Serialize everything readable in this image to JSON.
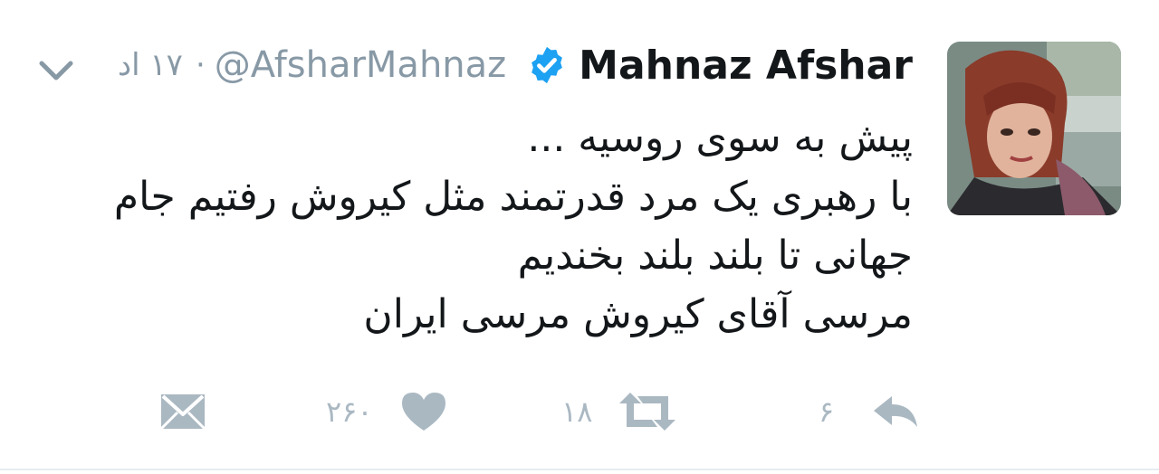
{
  "author": {
    "name": "Mahnaz Afshar",
    "handle": "@AfsharMahnaz",
    "time": "۱۷ اد",
    "separator": "·",
    "verified": true
  },
  "tweet": {
    "lines": [
      "پیش به سوی روسیه ...",
      "با رهبری یک مرد قدرتمند مثل کیروش رفتیم جام",
      "جهانی تا بلند بلند بخندیم",
      "مرسی آقای کیروش مرسی ایران"
    ]
  },
  "actions": {
    "reply_count": "۶",
    "retweet_count": "۱۸",
    "like_count": "۲۶۰"
  },
  "icons": {
    "menu": "chevron-down-icon",
    "verified": "verified-badge-icon",
    "reply": "reply-icon",
    "retweet": "retweet-icon",
    "like": "heart-icon",
    "message": "direct-message-icon"
  },
  "colors": {
    "name": "#14171a",
    "muted": "#8899a6",
    "action_icon": "#aab8c2",
    "verified": "#1da1f2"
  }
}
